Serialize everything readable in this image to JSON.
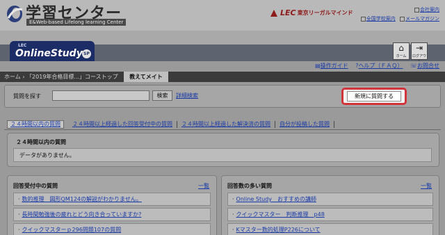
{
  "header": {
    "logo_title": "学習センター",
    "logo_subtitle": "E&Web-based Lifelong learning Center",
    "brand_lec": "LEC",
    "brand_name": "東京リーガルマインド",
    "links_row1": [
      {
        "label": "会社案内",
        "icon": "building-icon"
      }
    ],
    "links_row2": [
      {
        "label": "全国学校案内",
        "icon": "school-icon"
      },
      {
        "label": "メールマガジン",
        "icon": "mail-icon"
      }
    ]
  },
  "band": {
    "lec_label": "LEC",
    "product": "OnlineStudy",
    "sp_badge": "SP",
    "home_label": "ホーム",
    "logout_label": "ログアウト"
  },
  "sublinks": [
    {
      "label": "操作ガイド",
      "icon": "guide-icon"
    },
    {
      "label": "ヘルプ（ＦＡＱ）",
      "icon": "help-icon"
    },
    {
      "label": "お問合せ",
      "icon": "phone-icon"
    }
  ],
  "breadcrumb": {
    "items": [
      "ホーム",
      "「2019年合格目標...」コーストップ"
    ],
    "separator": "›",
    "current": "教えてメイト"
  },
  "search": {
    "label": "質問を探す",
    "input_value": "",
    "button_label": "検索",
    "advanced_link": "詳細検索",
    "ask_button": "新規に質問する"
  },
  "tabs": [
    "２４時間以内の質問",
    "２４時間以上経過した回答受付中の質問",
    "２４時間以上経過した解決済の質問",
    "自分が投稿した質問"
  ],
  "panel24": {
    "title": "２４時間以内の質問",
    "empty_text": "データがありません。"
  },
  "panel_left": {
    "title": "回答受付中の質問",
    "more": "一覧",
    "items": [
      "数的推理　図形QM124の解説がわかりません。",
      "長時間勉強後の疲れとどう向き合っていますか?",
      "クイックマスターｐ296問題107の質問"
    ]
  },
  "panel_right": {
    "title": "回答数の多い質問",
    "more": "一覧",
    "items": [
      "Online Study　おすすめの講師",
      "クイックマスター　判断推理　p48",
      "Kマスター数的処理P226について"
    ]
  },
  "colors": {
    "highlight_border": "#d2343c",
    "brand_navy": "#1c2c66",
    "link_blue": "#1a3aa8"
  }
}
